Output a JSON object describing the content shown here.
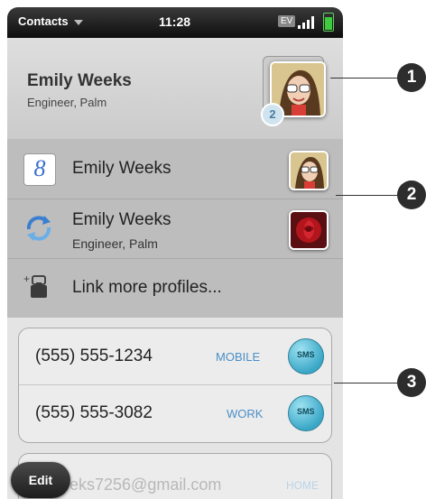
{
  "status_bar": {
    "app_menu": "Contacts",
    "time": "11:28",
    "network": "EV",
    "colors": {
      "battery": "#3ecb3e"
    }
  },
  "contact": {
    "name": "Emily Weeks",
    "title": "Engineer, Palm",
    "linked_profile_count": "2"
  },
  "profiles": [
    {
      "source_icon": "google-icon",
      "name": "Emily Weeks",
      "subtitle": ""
    },
    {
      "source_icon": "sync-icon",
      "name": "Emily Weeks",
      "subtitle": "Engineer, Palm"
    }
  ],
  "link_more": {
    "label": "Link more profiles...",
    "icon": "link-profiles-icon"
  },
  "phones": [
    {
      "number": "(555) 555-1234",
      "type": "MOBILE",
      "action": "SMS"
    },
    {
      "number": "(555) 555-3082",
      "type": "WORK",
      "action": "SMS"
    }
  ],
  "email": {
    "value": "eks7256@gmail.com",
    "type": "HOME"
  },
  "edit_button": "Edit",
  "callouts": [
    "1",
    "2",
    "3"
  ]
}
